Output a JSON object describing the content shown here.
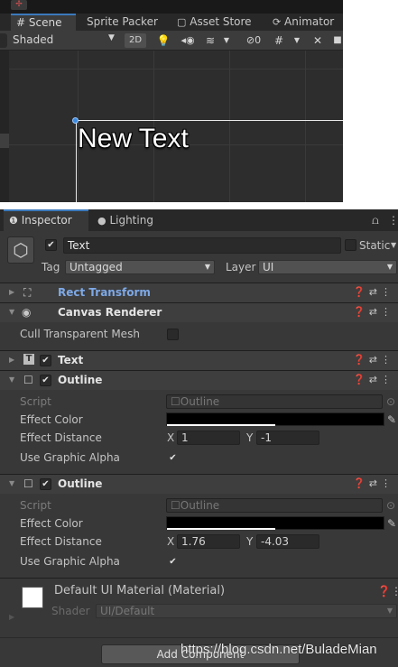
{
  "scene_tabs": [
    {
      "label": "# Scene",
      "active": true
    },
    {
      "label": "Sprite Packer",
      "active": false
    },
    {
      "label": "Asset Store",
      "icon": "bag-icon",
      "active": false
    },
    {
      "label": "Animator",
      "icon": "animator-icon",
      "active": false
    }
  ],
  "scene_toolbar": {
    "shading": "Shaded",
    "mode_2d": "2D",
    "hidden_count": "0"
  },
  "scene_canvas_text": "New Text",
  "inspector_tabs": [
    {
      "label": "Inspector",
      "icon": "info-icon",
      "active": true
    },
    {
      "label": "Lighting",
      "icon": "lightbulb-icon",
      "active": false
    }
  ],
  "object": {
    "name": "Text",
    "static_label": "Static",
    "tag_label": "Tag",
    "tag_value": "Untagged",
    "layer_label": "Layer",
    "layer_value": "UI"
  },
  "components": {
    "rect_transform": "Rect Transform",
    "canvas_renderer": "Canvas Renderer",
    "cull_label": "Cull Transparent Mesh",
    "text": "Text",
    "outline1": {
      "title": "Outline",
      "script_label": "Script",
      "script_value": "Outline",
      "color_label": "Effect Color",
      "color_value": "#000000",
      "distance_label": "Effect Distance",
      "x_label": "X",
      "x_value": "1",
      "y_label": "Y",
      "y_value": "-1",
      "alpha_label": "Use Graphic Alpha"
    },
    "outline2": {
      "title": "Outline",
      "script_label": "Script",
      "script_value": "Outline",
      "color_label": "Effect Color",
      "color_value": "#000000",
      "distance_label": "Effect Distance",
      "x_label": "X",
      "x_value": "1.76",
      "y_label": "Y",
      "y_value": "-4.03",
      "alpha_label": "Use Graphic Alpha"
    },
    "material": {
      "title": "Default UI Material (Material)",
      "shader_label": "Shader",
      "shader_value": "UI/Default"
    }
  },
  "add_component": "Add Component",
  "watermark": "https://blog.csdn.net/BuladeMian",
  "colors": {
    "accent": "#3a79bb",
    "link_blue": "#7ea9e6",
    "bg": "#383838"
  }
}
